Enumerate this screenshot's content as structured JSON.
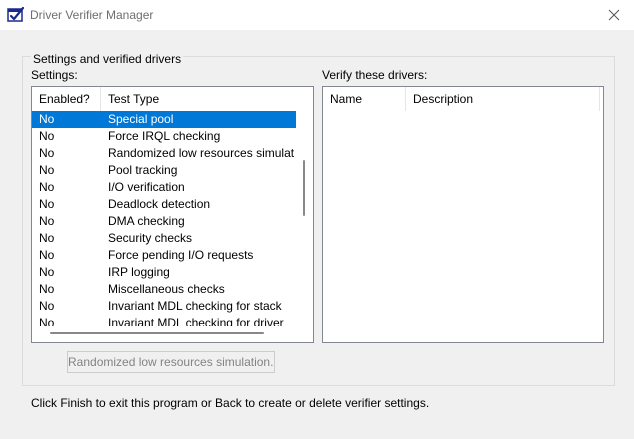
{
  "window": {
    "title": "Driver Verifier Manager"
  },
  "group": {
    "legend": "Settings and verified drivers",
    "settings_label": "Settings:",
    "verify_label": "Verify these drivers:"
  },
  "settings_table": {
    "columns": [
      "Enabled?",
      "Test Type"
    ],
    "selected_index": 0,
    "rows": [
      {
        "enabled": "No",
        "test_type": "Special pool"
      },
      {
        "enabled": "No",
        "test_type": "Force IRQL checking"
      },
      {
        "enabled": "No",
        "test_type": "Randomized low resources simulation"
      },
      {
        "enabled": "No",
        "test_type": "Pool tracking"
      },
      {
        "enabled": "No",
        "test_type": "I/O verification"
      },
      {
        "enabled": "No",
        "test_type": "Deadlock detection"
      },
      {
        "enabled": "No",
        "test_type": "DMA checking"
      },
      {
        "enabled": "No",
        "test_type": "Security checks"
      },
      {
        "enabled": "No",
        "test_type": "Force pending I/O requests"
      },
      {
        "enabled": "No",
        "test_type": "IRP logging"
      },
      {
        "enabled": "No",
        "test_type": "Miscellaneous checks"
      },
      {
        "enabled": "No",
        "test_type": "Invariant MDL checking for stack"
      },
      {
        "enabled": "No",
        "test_type": "Invariant MDL checking for driver"
      }
    ]
  },
  "drivers_table": {
    "columns": [
      "Name",
      "Description"
    ]
  },
  "buttons": {
    "simulation": "Randomized low resources simulation..."
  },
  "footer": {
    "instructions": "Click Finish to exit this program or Back to create or delete verifier settings."
  },
  "colors": {
    "selection": "#0078d7",
    "window_bg": "#f0f0f0",
    "list_border": "#828790"
  }
}
